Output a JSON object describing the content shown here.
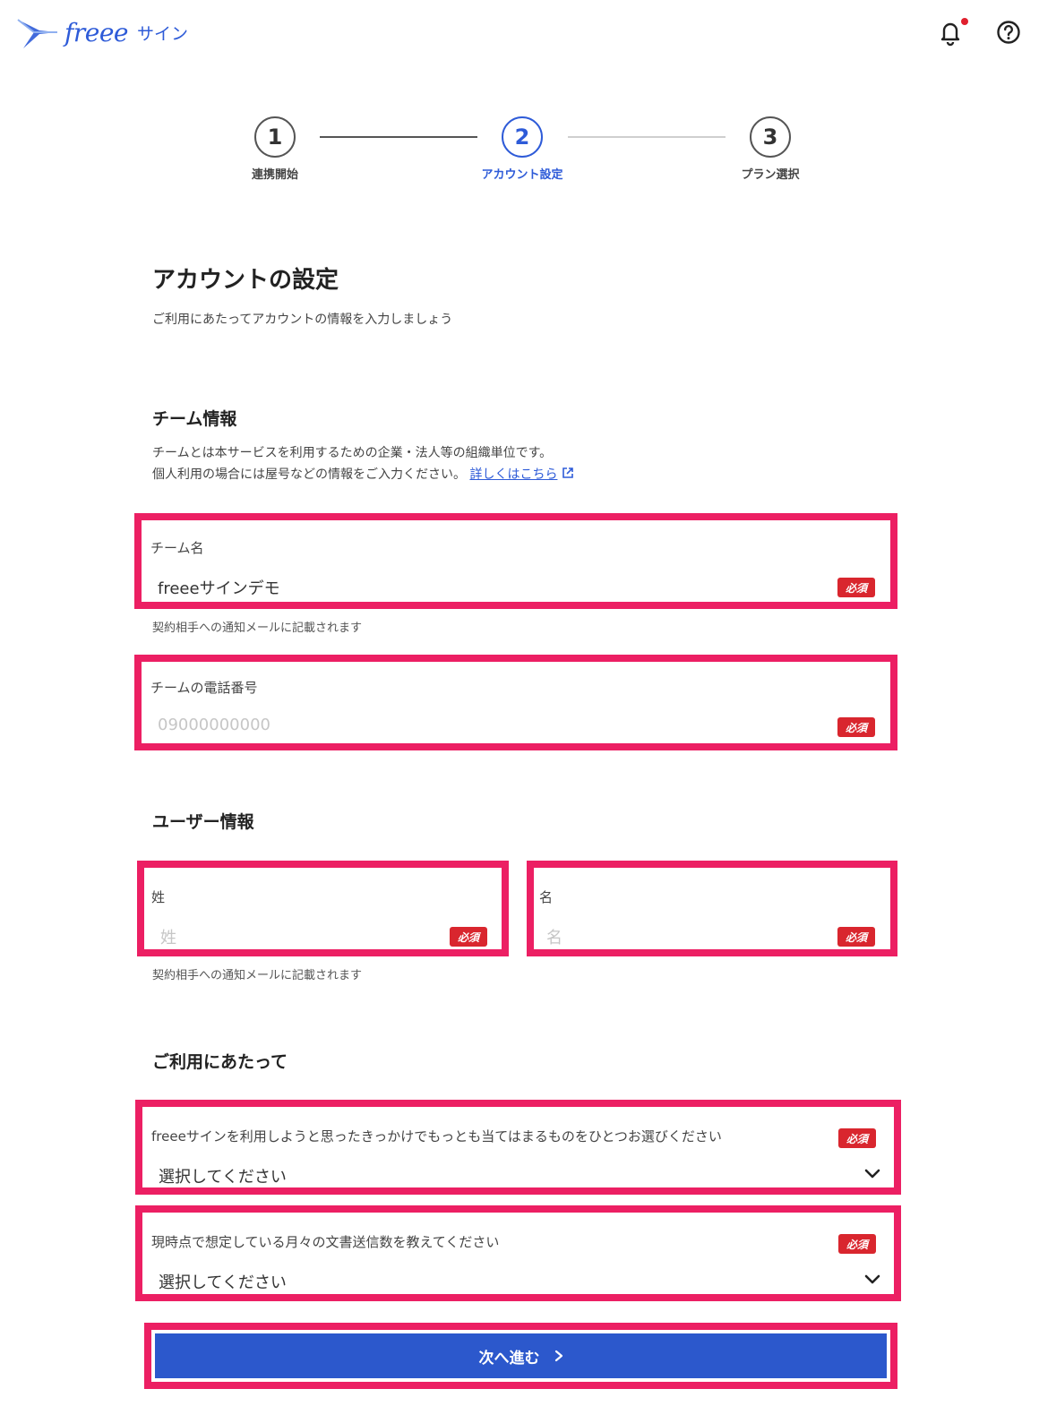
{
  "header": {
    "logo_word": "freee",
    "logo_sub": "サイン",
    "bell_icon": "bell-icon",
    "help_icon": "help-circle-icon"
  },
  "stepper": {
    "steps": [
      {
        "number": "1",
        "label": "連携開始"
      },
      {
        "number": "2",
        "label": "アカウント設定"
      },
      {
        "number": "3",
        "label": "プラン選択"
      }
    ],
    "active_step": 2
  },
  "page": {
    "title": "アカウントの設定",
    "subtitle": "ご利用にあたってアカウントの情報を入力しましょう"
  },
  "team": {
    "heading": "チーム情報",
    "desc_line1": "チームとは本サービスを利用するための企業・法人等の組織単位です。",
    "desc_line2": "個人利用の場合には屋号などの情報をご入力ください。",
    "link_text": "詳しくはこちら",
    "name_label": "チーム名",
    "name_value": "freeeサインデモ",
    "name_hint": "契約相手への通知メールに記載されます",
    "phone_label": "チームの電話番号",
    "phone_placeholder": "09000000000"
  },
  "user": {
    "heading": "ユーザー情報",
    "last_label": "姓",
    "last_placeholder": "姓",
    "first_label": "名",
    "first_placeholder": "名",
    "hint": "契約相手への通知メールに記載されます"
  },
  "usage": {
    "heading": "ご利用にあたって",
    "reason_label": "freeeサインを利用しようと思ったきっかけでもっとも当てはまるものをひとつお選びください",
    "reason_value": "選択してください",
    "volume_label": "現時点で想定している月々の文書送信数を教えてください",
    "volume_value": "選択してください"
  },
  "required_badge": "必須",
  "submit_label": "次へ進む",
  "colors": {
    "accent": "#2e5bd8",
    "button": "#2c58cc",
    "required": "#d9262e",
    "highlight": "#ec1f63"
  }
}
